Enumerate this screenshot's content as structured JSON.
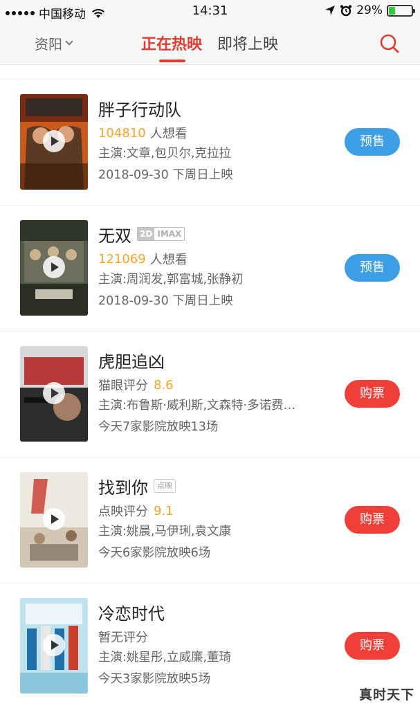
{
  "status_bar": {
    "carrier": "中国移动",
    "time": "14:31",
    "battery_text": "29%",
    "battery_level": 0.29,
    "icons": [
      "signal-icon",
      "wifi-icon",
      "location-icon",
      "alarm-icon",
      "battery-icon"
    ]
  },
  "header": {
    "city": "资阳",
    "tabs": [
      {
        "label": "正在热映",
        "active": true
      },
      {
        "label": "即将上映",
        "active": false
      }
    ],
    "search_icon": "search-icon",
    "accent_color": "#e23b32"
  },
  "movies": [
    {
      "title": "胖子行动队",
      "tags": [],
      "metric_value": "104810",
      "metric_label": "人想看",
      "cast": "主演:文章,包贝尔,克拉拉",
      "schedule": "2018-09-30 下周日上映",
      "button": "预售",
      "button_color": "#3c9fe6"
    },
    {
      "title": "无双",
      "tags": [
        "2D",
        "IMAX"
      ],
      "metric_value": "121069",
      "metric_label": "人想看",
      "cast": "主演:周润发,郭富城,张静初",
      "schedule": "2018-09-30 下周日上映",
      "button": "预售",
      "button_color": "#3c9fe6"
    },
    {
      "title": "虎胆追凶",
      "tags": [],
      "metric_label": "猫眼评分",
      "metric_value": "8.6",
      "cast": "主演:布鲁斯·威利斯,文森特·多诺费…",
      "schedule": "今天7家影院放映13场",
      "button": "购票",
      "button_color": "#ef3f38"
    },
    {
      "title": "找到你",
      "tags": [
        "点映"
      ],
      "metric_label": "点映评分",
      "metric_value": "9.1",
      "cast": "主演:姚晨,马伊琍,袁文康",
      "schedule": "今天6家影院放映6场",
      "button": "购票",
      "button_color": "#ef3f38"
    },
    {
      "title": "冷恋时代",
      "tags": [],
      "metric_label": "暂无评分",
      "metric_value": "",
      "cast": "主演:姚星彤,立威廉,董琦",
      "schedule": "今天3家影院放映5场",
      "button": "购票",
      "button_color": "#ef3f38"
    }
  ],
  "posters": [
    {
      "name": "fat-squad-poster",
      "text": "胖子行动队"
    },
    {
      "name": "project-gutenberg-poster",
      "text": "无双"
    },
    {
      "name": "death-wish-poster",
      "text": "虎胆追凶"
    },
    {
      "name": "missing-poster",
      "text": "找到你"
    },
    {
      "name": "ice-dream-poster",
      "text": "冷恋时代"
    }
  ],
  "watermark": "真时天下"
}
